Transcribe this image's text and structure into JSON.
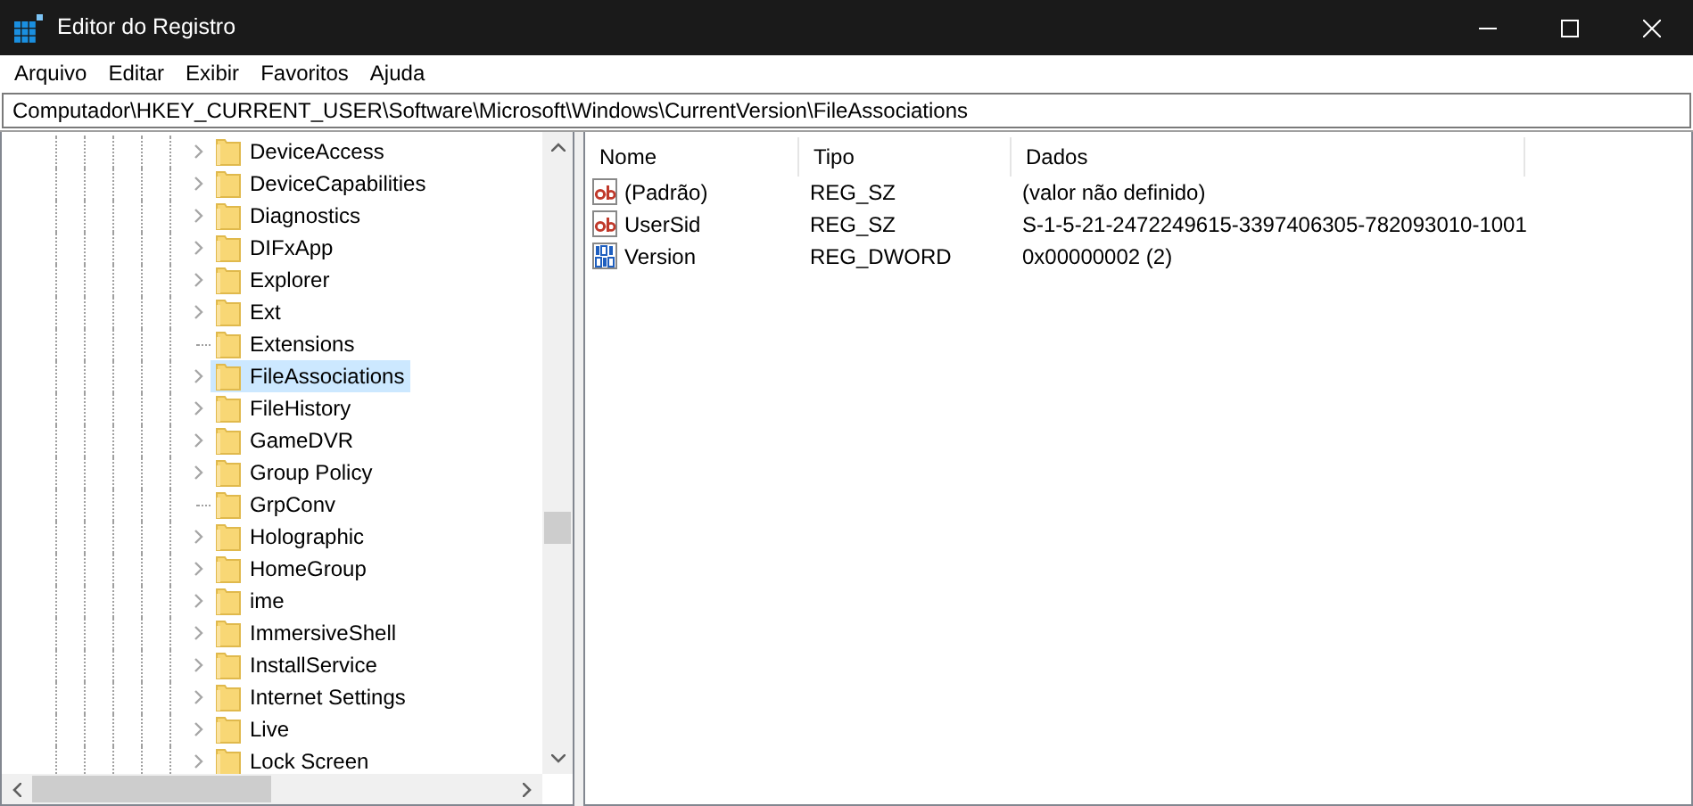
{
  "window": {
    "title": "Editor do Registro"
  },
  "menu": [
    "Arquivo",
    "Editar",
    "Exibir",
    "Favoritos",
    "Ajuda"
  ],
  "address": "Computador\\HKEY_CURRENT_USER\\Software\\Microsoft\\Windows\\CurrentVersion\\FileAssociations",
  "tree": [
    {
      "label": "DeviceAccess",
      "kind": "expandable",
      "selected": false
    },
    {
      "label": "DeviceCapabilities",
      "kind": "expandable",
      "selected": false
    },
    {
      "label": "Diagnostics",
      "kind": "expandable",
      "selected": false
    },
    {
      "label": "DIFxApp",
      "kind": "expandable",
      "selected": false
    },
    {
      "label": "Explorer",
      "kind": "expandable",
      "selected": false
    },
    {
      "label": "Ext",
      "kind": "expandable",
      "selected": false
    },
    {
      "label": "Extensions",
      "kind": "leaf",
      "selected": false
    },
    {
      "label": "FileAssociations",
      "kind": "expandable",
      "selected": true
    },
    {
      "label": "FileHistory",
      "kind": "expandable",
      "selected": false
    },
    {
      "label": "GameDVR",
      "kind": "expandable",
      "selected": false
    },
    {
      "label": "Group Policy",
      "kind": "expandable",
      "selected": false
    },
    {
      "label": "GrpConv",
      "kind": "leaf",
      "selected": false
    },
    {
      "label": "Holographic",
      "kind": "expandable",
      "selected": false
    },
    {
      "label": "HomeGroup",
      "kind": "expandable",
      "selected": false
    },
    {
      "label": "ime",
      "kind": "expandable",
      "selected": false
    },
    {
      "label": "ImmersiveShell",
      "kind": "expandable",
      "selected": false
    },
    {
      "label": "InstallService",
      "kind": "expandable",
      "selected": false
    },
    {
      "label": "Internet Settings",
      "kind": "expandable",
      "selected": false
    },
    {
      "label": "Live",
      "kind": "expandable",
      "selected": false
    },
    {
      "label": "Lock Screen",
      "kind": "expandable",
      "selected": false
    }
  ],
  "values": {
    "columns": [
      "Nome",
      "Tipo",
      "Dados"
    ],
    "rows": [
      {
        "kind": "string",
        "name": "(Padrão)",
        "type": "REG_SZ",
        "data": "(valor não definido)"
      },
      {
        "kind": "string",
        "name": "UserSid",
        "type": "REG_SZ",
        "data": "S-1-5-21-2472249615-3397406305-782093010-1001"
      },
      {
        "kind": "dword",
        "name": "Version",
        "type": "REG_DWORD",
        "data": "0x00000002 (2)"
      }
    ]
  }
}
